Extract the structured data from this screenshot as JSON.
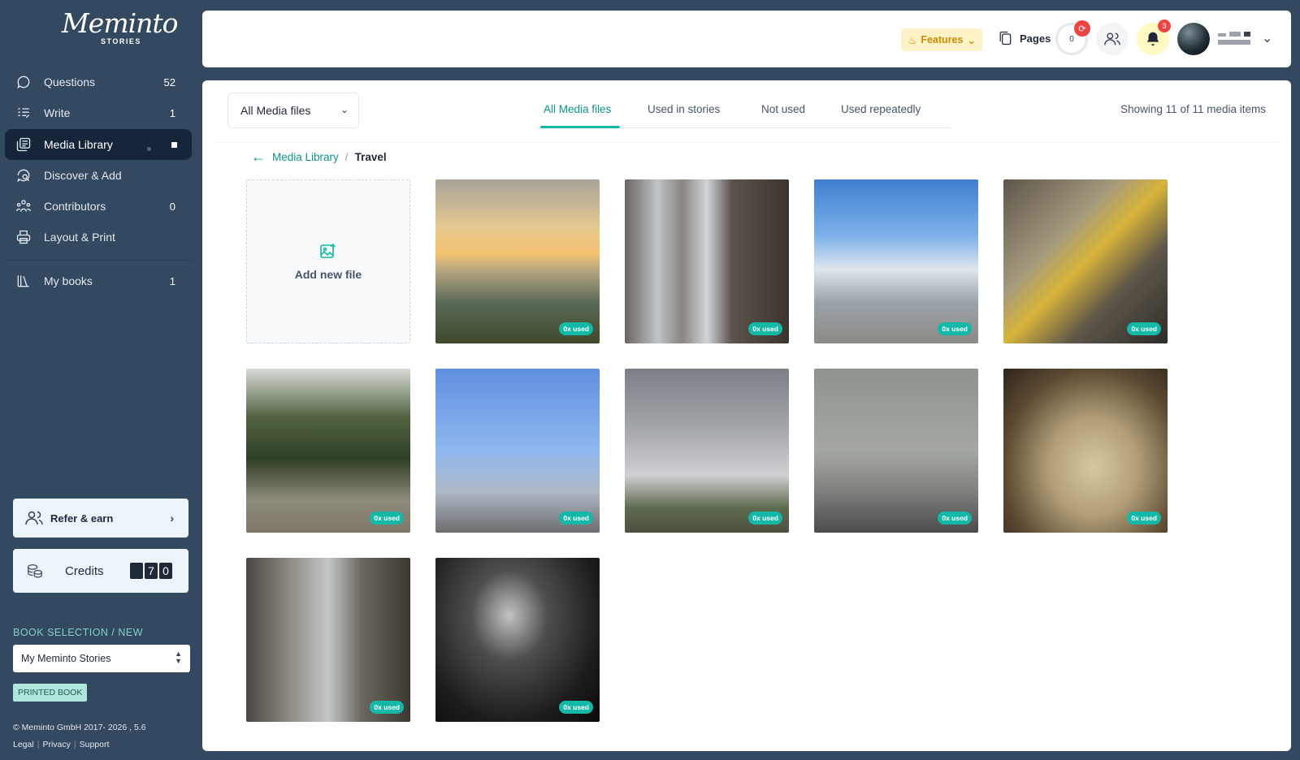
{
  "sidebar": {
    "logo_script": "Meminto",
    "logo_sub": "STORIES",
    "nav": [
      {
        "label": "Questions",
        "count": "52",
        "icon": "chat-icon"
      },
      {
        "label": "Write",
        "count": "1",
        "icon": "write-icon"
      },
      {
        "label": "Media Library",
        "count": "",
        "icon": "media-library-icon",
        "active": true
      },
      {
        "label": "Discover & Add",
        "count": "",
        "icon": "discover-icon"
      },
      {
        "label": "Contributors",
        "count": "0",
        "icon": "contributors-icon"
      },
      {
        "label": "Layout & Print",
        "count": "",
        "icon": "printer-icon"
      },
      {
        "label": "My books",
        "count": "1",
        "icon": "books-icon"
      }
    ],
    "refer_label": "Refer & earn",
    "credits_label": "Credits",
    "credits_digits": [
      "",
      "7",
      "0"
    ],
    "book_selection_label": "BOOK SELECTION / NEW",
    "book_selected": "My Meminto Stories",
    "printed_badge": "PRINTED BOOK",
    "copyright": "© Meminto GmbH 2017- 2026 , 5.6",
    "footer_links": [
      "Legal",
      "Privacy",
      "Support"
    ]
  },
  "topbar": {
    "features_label": "Features",
    "pages_label": "Pages",
    "counter_value": "0",
    "notifications_count": "3"
  },
  "main": {
    "filter_selected": "All Media files",
    "tabs": [
      "All Media files",
      "Used in stories",
      "Not used",
      "Used repeatedly"
    ],
    "active_tab": "All Media files",
    "showing_text": "Showing 11 of 11 media items",
    "breadcrumb": {
      "parent": "Media Library",
      "current": "Travel"
    },
    "add_new_label": "Add new file",
    "media": [
      {
        "used": "0x used",
        "description": "sunset over harbor"
      },
      {
        "used": "0x used",
        "description": "city street with skyscrapers"
      },
      {
        "used": "0x used",
        "description": "airplane boarding"
      },
      {
        "used": "0x used",
        "description": "glass pyramid atrium"
      },
      {
        "used": "0x used",
        "description": "forest waterfall rocks"
      },
      {
        "used": "0x used",
        "description": "airport tarmac blue sky"
      },
      {
        "used": "0x used",
        "description": "cloudy sky over town"
      },
      {
        "used": "0x used",
        "description": "foggy highway"
      },
      {
        "used": "0x used",
        "description": "old town through archway"
      },
      {
        "used": "0x used",
        "description": "rainy city street taxis"
      },
      {
        "used": "0x used",
        "description": "dark water ripples"
      }
    ]
  },
  "colors": {
    "accent": "#14b8a6",
    "sidebar_bg": "#33495f",
    "badge_red": "#ef4444"
  }
}
